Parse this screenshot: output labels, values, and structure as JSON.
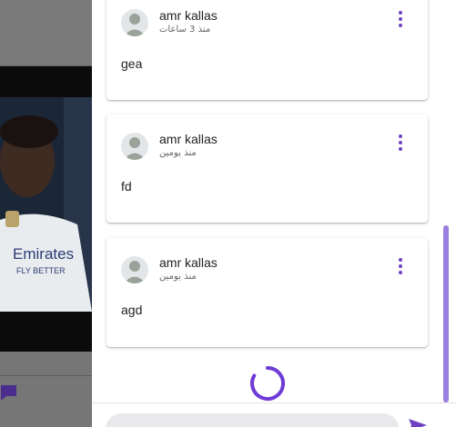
{
  "comments": [
    {
      "author": "amr kallas",
      "time": "منذ 3 ساعات",
      "text": "gea"
    },
    {
      "author": "amr kallas",
      "time": "منذ يومين",
      "text": "fd"
    },
    {
      "author": "amr kallas",
      "time": "منذ يومين",
      "text": "agd"
    }
  ],
  "composer": {
    "placeholder": ""
  },
  "background": {
    "jersey_text": "Emirates FLY BETTER"
  },
  "colors": {
    "accent": "#6f42c1",
    "scroll": "#9b7fe0",
    "overlay": "#6b6b6b"
  },
  "icons": {
    "menu": "more-vertical-icon",
    "avatar": "person-icon",
    "send": "send-icon",
    "loading": "spinner-icon",
    "chat": "chat-icon"
  }
}
